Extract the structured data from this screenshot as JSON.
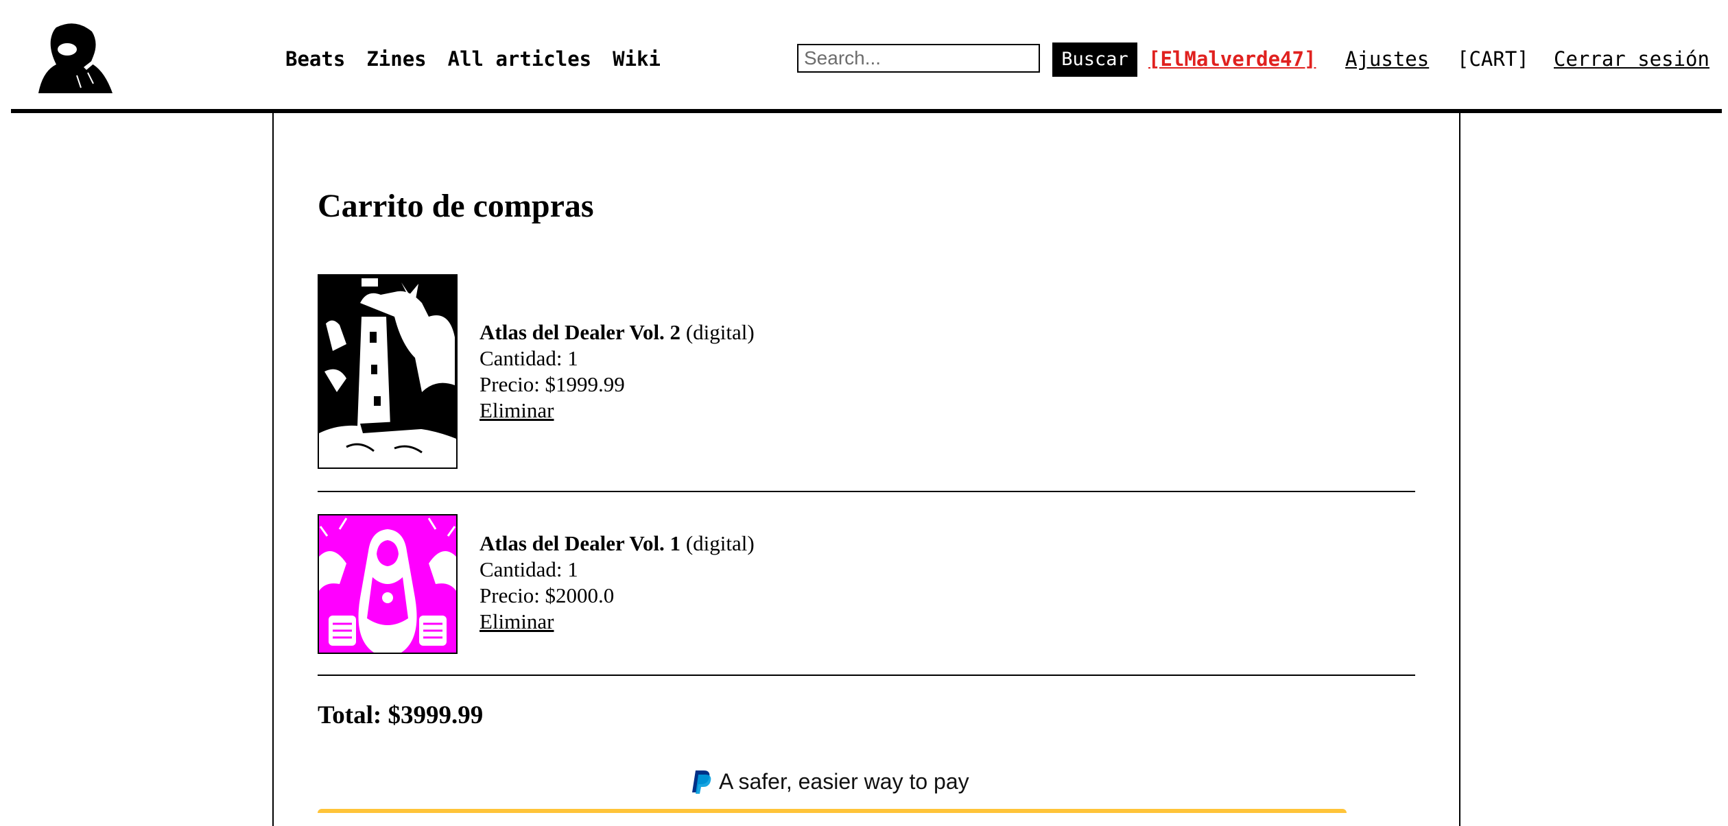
{
  "nav": {
    "items": [
      "Beats",
      "Zines",
      "All articles",
      "Wiki"
    ]
  },
  "search": {
    "placeholder": "Search...",
    "button_label": "Buscar"
  },
  "account": {
    "username": "[ElMalverde47]",
    "settings_label": "Ajustes",
    "cart_label": "[CART]",
    "logout_label": "Cerrar sesión"
  },
  "cart": {
    "title": "Carrito de compras",
    "items": [
      {
        "name": "Atlas del Dealer Vol. 2",
        "format": "(digital)",
        "quantity": "Cantidad: 1",
        "price": "Precio: $1999.99",
        "remove_label": "Eliminar",
        "cover_color": "#000000"
      },
      {
        "name": "Atlas del Dealer Vol. 1",
        "format": "(digital)",
        "quantity": "Cantidad: 1",
        "price": "Precio: $2000.0",
        "remove_label": "Eliminar",
        "cover_color": "#ff00ff"
      }
    ],
    "total": "Total: $3999.99"
  },
  "paypal": {
    "tagline": "A safer, easier way to pay",
    "button_color": "#ffc439"
  },
  "colors": {
    "username": "#e0211f",
    "accent_button": "#000000"
  }
}
